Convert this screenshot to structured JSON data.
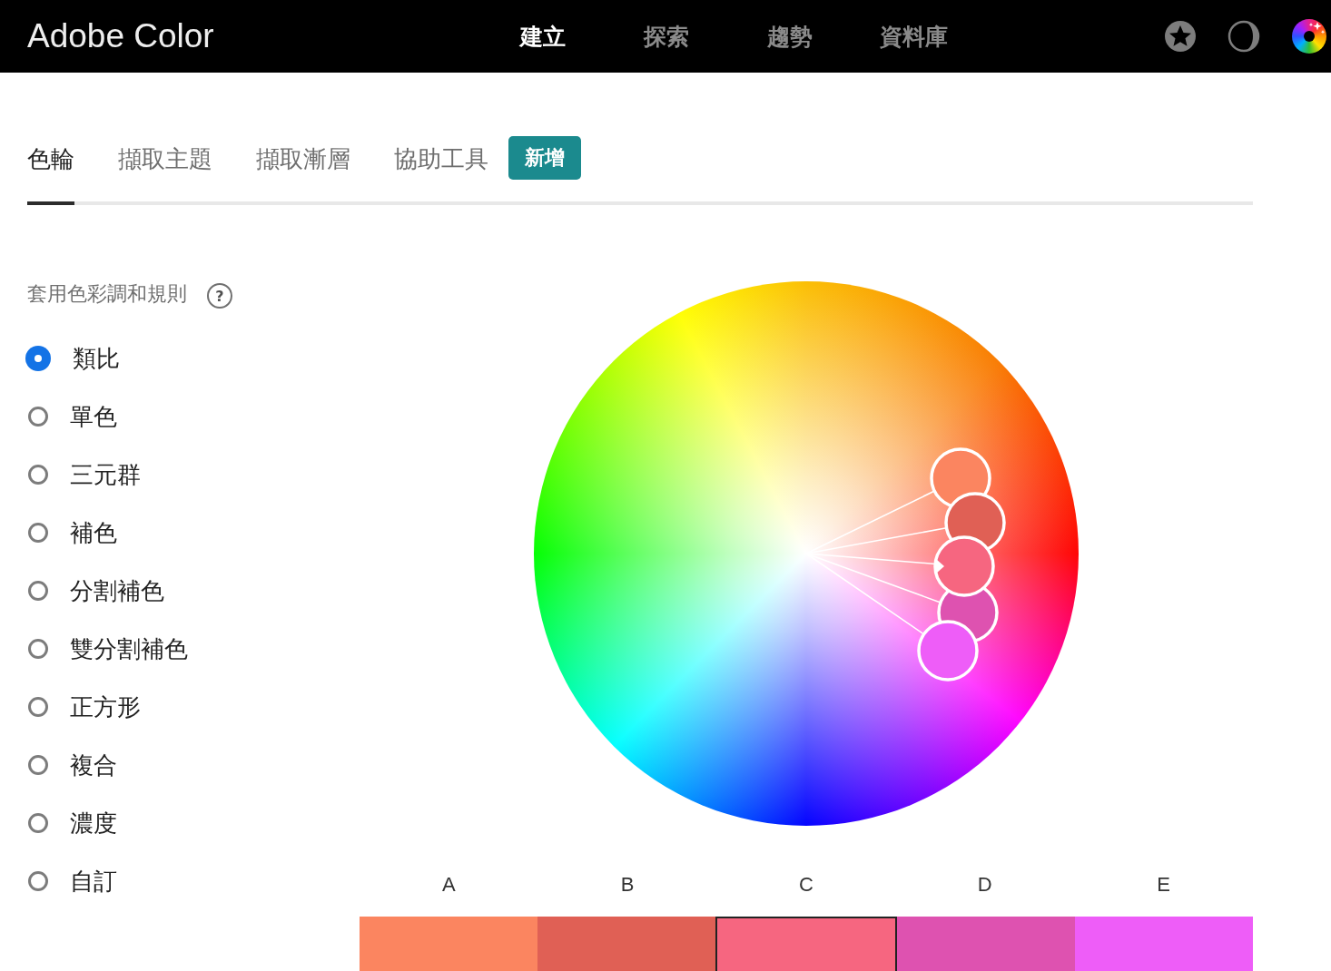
{
  "header": {
    "logo": "Adobe Color",
    "nav": [
      {
        "label": "建立",
        "selected": true
      },
      {
        "label": "探索",
        "selected": false
      },
      {
        "label": "趨勢",
        "selected": false
      },
      {
        "label": "資料庫",
        "selected": false
      }
    ]
  },
  "tabs": [
    {
      "label": "色輪",
      "selected": true
    },
    {
      "label": "擷取主題",
      "selected": false
    },
    {
      "label": "擷取漸層",
      "selected": false
    },
    {
      "label": "協助工具",
      "selected": false,
      "badge": "新增"
    }
  ],
  "harmony": {
    "title": "套用色彩調和規則",
    "help": "?",
    "options": [
      {
        "label": "類比",
        "selected": true
      },
      {
        "label": "單色",
        "selected": false
      },
      {
        "label": "三元群",
        "selected": false
      },
      {
        "label": "補色",
        "selected": false
      },
      {
        "label": "分割補色",
        "selected": false
      },
      {
        "label": "雙分割補色",
        "selected": false
      },
      {
        "label": "正方形",
        "selected": false
      },
      {
        "label": "複合",
        "selected": false
      },
      {
        "label": "濃度",
        "selected": false
      },
      {
        "label": "自訂",
        "selected": false
      }
    ]
  },
  "swatches": [
    {
      "label": "A",
      "color": "#fb8560",
      "selected": false
    },
    {
      "label": "B",
      "color": "#e06055",
      "selected": false
    },
    {
      "label": "C",
      "color": "#f66680",
      "selected": true
    },
    {
      "label": "D",
      "color": "#de52b0",
      "selected": false
    },
    {
      "label": "E",
      "color": "#ee5df8",
      "selected": false
    }
  ]
}
